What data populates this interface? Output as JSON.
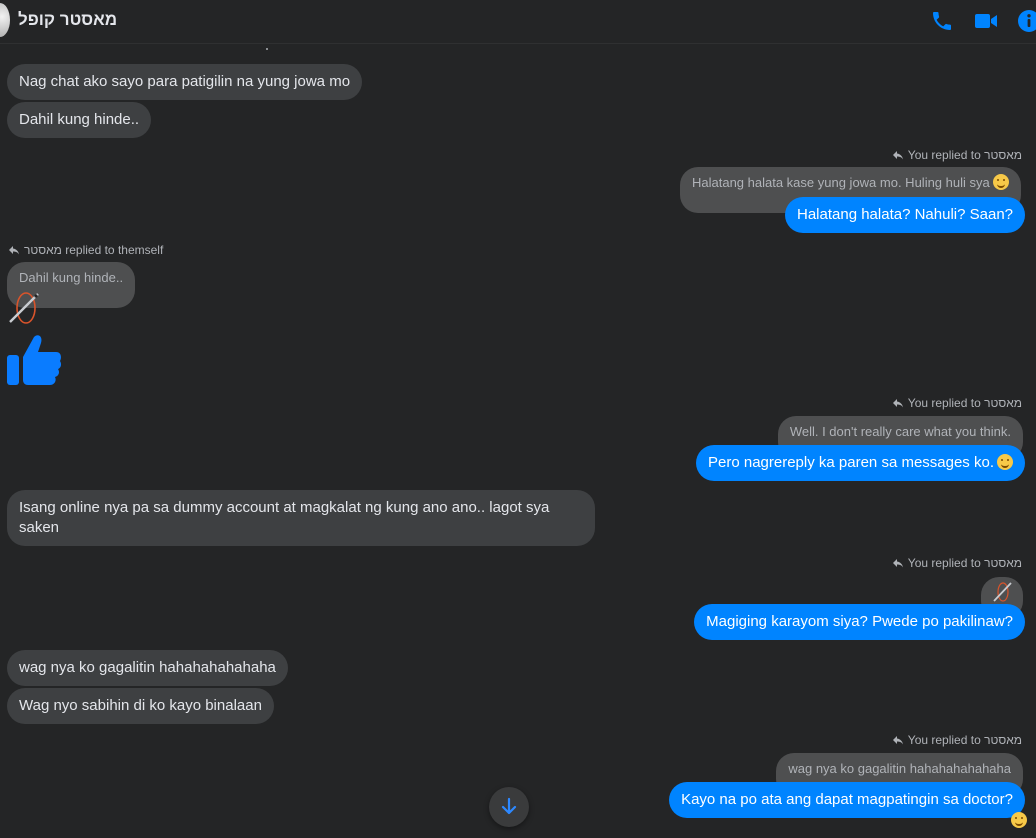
{
  "header": {
    "title": "מאסטר קופל",
    "icons": [
      "phone-icon",
      "video-icon",
      "info-icon"
    ],
    "accent_color": "#0084ff"
  },
  "messages": {
    "m1": "Nag chat ako sayo para patigilin na yung jowa mo",
    "m2": "Dahil kung hinde..",
    "r1_meta": "You replied to מאסטר",
    "r1_quote": "Halatang halata kase yung jowa mo. Huling huli sya",
    "r1_reply": "Halatang halata? Nahuli? Saan?",
    "r2_meta": "מאסטר replied to themself",
    "r2_quote": "Dahil kung hinde..",
    "r3_meta": "You replied to מאסטר",
    "r3_quote": "Well. I don't really care what you think.",
    "r3_reply": "Pero nagrereply ka paren sa  messages ko.",
    "m3_line1": "Isang online nya pa sa dummy account at magkalat ng kung ano ano.. lagot sya",
    "m3_line2": "saken",
    "r4_meta": "You replied to מאסטר",
    "r4_reply": "Magiging karayom siya? Pwede po pakilinaw?",
    "m4": "wag nya ko gagalitin hahahahahahaha",
    "m5": "Wag nyo sabihin di ko kayo binalaan",
    "r5_meta": "You replied to מאסטר",
    "r5_quote": "wag nya ko gagalitin hahahahahahaha",
    "r5_reply": "Kayo na po ata ang dapat magpatingin sa doctor?"
  },
  "colors": {
    "background": "#242526",
    "incoming_bubble": "#3e4042",
    "outgoing_bubble": "#0084ff",
    "quoted_bubble": "#4e4f50"
  }
}
